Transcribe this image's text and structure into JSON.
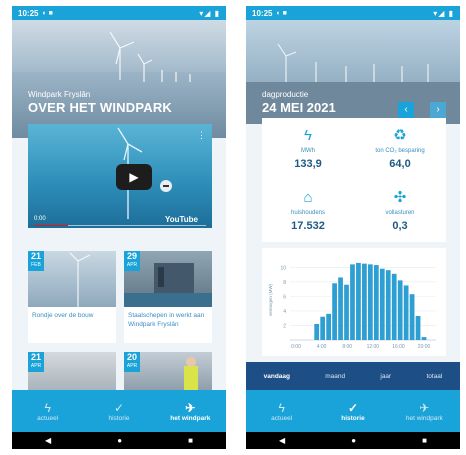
{
  "colors": {
    "primary": "#1aa3d9",
    "dark": "#1d4f86",
    "bar": "#2e9fd2"
  },
  "status": {
    "time": "10:25",
    "icons": "◐ ■",
    "right": "▾◢ ▮"
  },
  "phone1": {
    "hero_subtitle": "Windpark Fryslân",
    "hero_title": "OVER HET WINDPARK",
    "video": {
      "time": "0:00",
      "brand": "YouTube",
      "menu": "⋮",
      "play": "▶"
    },
    "cards": [
      {
        "day": "21",
        "month": "FEB",
        "caption": "Rondje over de bouw"
      },
      {
        "day": "29",
        "month": "APR",
        "caption": "Staalschepen in werkt aan Windpark Fryslân"
      },
      {
        "day": "21",
        "month": "APR",
        "caption": ""
      },
      {
        "day": "20",
        "month": "APR",
        "caption": ""
      }
    ],
    "nav": [
      {
        "icon": "ϟ",
        "label": "actueel"
      },
      {
        "icon": "✓",
        "label": "historie"
      },
      {
        "icon": "✈",
        "label": "het windpark"
      }
    ]
  },
  "phone2": {
    "hero_subtitle": "dagproductie",
    "hero_title": "24 MEI 2021",
    "prev": "‹",
    "next": "›",
    "stats": [
      {
        "icon": "ϟ",
        "label": "MWh",
        "value": "133,9"
      },
      {
        "icon": "♻",
        "label": "ton CO₂ besparing",
        "value": "64,0"
      },
      {
        "icon": "⌂",
        "label": "huishoudens",
        "value": "17.532"
      },
      {
        "icon": "✣",
        "label": "vollasturen",
        "value": "0,3"
      }
    ],
    "tabs": [
      "vandaag",
      "maand",
      "jaar",
      "totaal"
    ],
    "nav": [
      {
        "icon": "ϟ",
        "label": "actueel"
      },
      {
        "icon": "✓",
        "label": "historie"
      },
      {
        "icon": "✈",
        "label": "het windpark"
      }
    ]
  },
  "sysnav": {
    "back": "◀",
    "home": "●",
    "recents": "■"
  },
  "chart_data": {
    "type": "bar",
    "ylabel": "vermogen (MW)",
    "x": [
      "0:00",
      "2:00",
      "4:00",
      "6:00",
      "8:00",
      "10:00",
      "12:00",
      "14:00",
      "16:00",
      "18:00",
      "20:00",
      "22:00"
    ],
    "xticks": [
      "0:00",
      "4:00",
      "8:00",
      "12:00",
      "16:00",
      "20:00"
    ],
    "yticks": [
      "2",
      "4",
      "6",
      "8",
      "10"
    ],
    "ylim": [
      0,
      11
    ],
    "values": [
      2.2,
      3.2,
      3.6,
      7.8,
      8.6,
      7.6,
      10.4,
      10.6,
      10.5,
      10.4,
      10.3,
      9.8,
      9.6,
      9.1,
      8.2,
      7.5,
      6.3,
      3.3,
      0.4
    ]
  }
}
